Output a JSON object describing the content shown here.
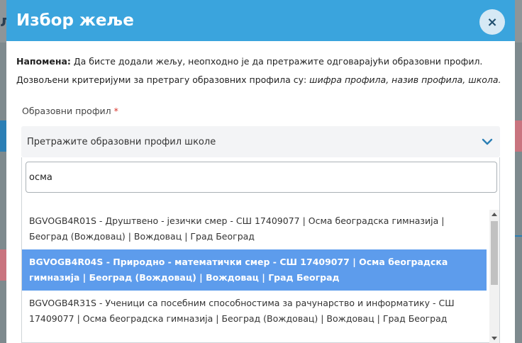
{
  "modal": {
    "title": "Избор жеље",
    "close_label": "×",
    "note_label": "Напомена:",
    "note_text": " Да бисте додали жељу, неопходно је да претражите одговарајући образовни профил.",
    "criteria_prefix": "Дозвољени критеријуми за претрагу образовних профила су: ",
    "criteria_items": "шифра профила, назив профила, школа."
  },
  "field": {
    "label": "Образовни профил",
    "required_mark": "*",
    "select_placeholder": "Претражите образовни профил школе"
  },
  "search": {
    "value": "осма"
  },
  "options": [
    {
      "text": "BGVOGB4R01S - Друштвено - језички смер - СШ 17409077 | Осма београдска гимназија | Београд (Вождовац) | Вождовац | Град Београд",
      "selected": false
    },
    {
      "text": "BGVOGB4R04S - Природно - математички смер - СШ 17409077 | Осма београдска гимназија | Београд (Вождовац) | Вождовац | Град Београд",
      "selected": true
    },
    {
      "text": "BGVOGB4R31S - Ученици са посебним способностима за рачунарство и информатику - СШ 17409077 | Осма београдска гимназија | Београд (Вождовац) | Вождовац | Град Београд",
      "selected": false
    }
  ],
  "background": {
    "letter": "л"
  },
  "colors": {
    "header": "#3aa4dd",
    "selected_option": "#5d9cec",
    "required": "#d9342b"
  }
}
